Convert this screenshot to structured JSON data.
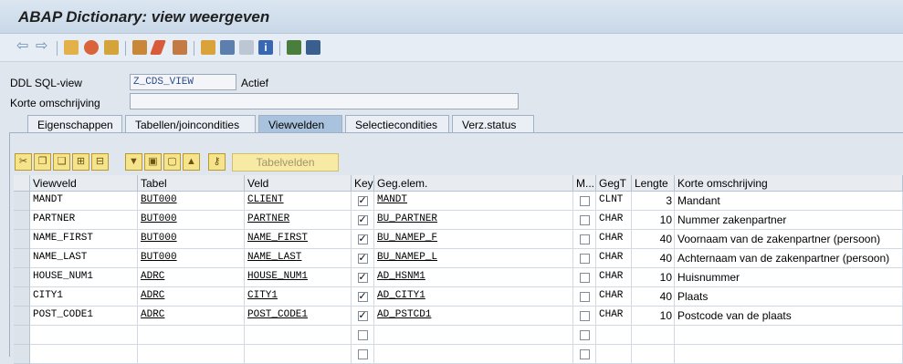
{
  "title": "ABAP Dictionary: view weergeven",
  "toolbar": {
    "icons": [
      "back-icon",
      "forward-icon",
      "edit-pen-icon",
      "other-object-icon",
      "activate-icon",
      "check-icon",
      "edit-icon",
      "where-used-icon",
      "hierarchy-icon",
      "list-icon",
      "display-icon",
      "info-icon",
      "documentation-icon",
      "table-icon"
    ]
  },
  "form": {
    "ddl_label": "DDL SQL-view",
    "ddl_value": "Z_CDS_VIEW",
    "status": "Actief",
    "desc_label": "Korte omschrijving",
    "desc_value": ""
  },
  "tabs": [
    "Eigenschappen",
    "Tabellen/joincondities",
    "Viewvelden",
    "Selectiecondities",
    "Verz.status"
  ],
  "active_tab": "Viewvelden",
  "table_toolbar": {
    "button_label": "Tabelvelden"
  },
  "columns": [
    "Viewveld",
    "Tabel",
    "Veld",
    "Key",
    "Geg.elem.",
    "M...",
    "GegT",
    "Lengte",
    "Korte omschrijving"
  ],
  "rows": [
    {
      "viewveld": "MANDT",
      "tabel": "BUT000",
      "veld": "CLIENT",
      "key": true,
      "gegelem": "MANDT",
      "m": false,
      "gegt": "CLNT",
      "lengte": "3",
      "omschrijving": "Mandant"
    },
    {
      "viewveld": "PARTNER",
      "tabel": "BUT000",
      "veld": "PARTNER",
      "key": true,
      "gegelem": "BU_PARTNER",
      "m": false,
      "gegt": "CHAR",
      "lengte": "10",
      "omschrijving": "Nummer zakenpartner"
    },
    {
      "viewveld": "NAME_FIRST",
      "tabel": "BUT000",
      "veld": "NAME_FIRST",
      "key": true,
      "gegelem": "BU_NAMEP_F",
      "m": false,
      "gegt": "CHAR",
      "lengte": "40",
      "omschrijving": "Voornaam van de zakenpartner (persoon)"
    },
    {
      "viewveld": "NAME_LAST",
      "tabel": "BUT000",
      "veld": "NAME_LAST",
      "key": true,
      "gegelem": "BU_NAMEP_L",
      "m": false,
      "gegt": "CHAR",
      "lengte": "40",
      "omschrijving": "Achternaam van de zakenpartner (persoon)"
    },
    {
      "viewveld": "HOUSE_NUM1",
      "tabel": "ADRC",
      "veld": "HOUSE_NUM1",
      "key": true,
      "gegelem": "AD_HSNM1",
      "m": false,
      "gegt": "CHAR",
      "lengte": "10",
      "omschrijving": "Huisnummer"
    },
    {
      "viewveld": "CITY1",
      "tabel": "ADRC",
      "veld": "CITY1",
      "key": true,
      "gegelem": "AD_CITY1",
      "m": false,
      "gegt": "CHAR",
      "lengte": "40",
      "omschrijving": "Plaats"
    },
    {
      "viewveld": "POST_CODE1",
      "tabel": "ADRC",
      "veld": "POST_CODE1",
      "key": true,
      "gegelem": "AD_PSTCD1",
      "m": false,
      "gegt": "CHAR",
      "lengte": "10",
      "omschrijving": "Postcode van de plaats"
    },
    {
      "viewveld": "",
      "tabel": "",
      "veld": "",
      "key": false,
      "gegelem": "",
      "m": false,
      "gegt": "",
      "lengte": "",
      "omschrijving": ""
    },
    {
      "viewveld": "",
      "tabel": "",
      "veld": "",
      "key": false,
      "gegelem": "",
      "m": false,
      "gegt": "",
      "lengte": "",
      "omschrijving": ""
    }
  ]
}
